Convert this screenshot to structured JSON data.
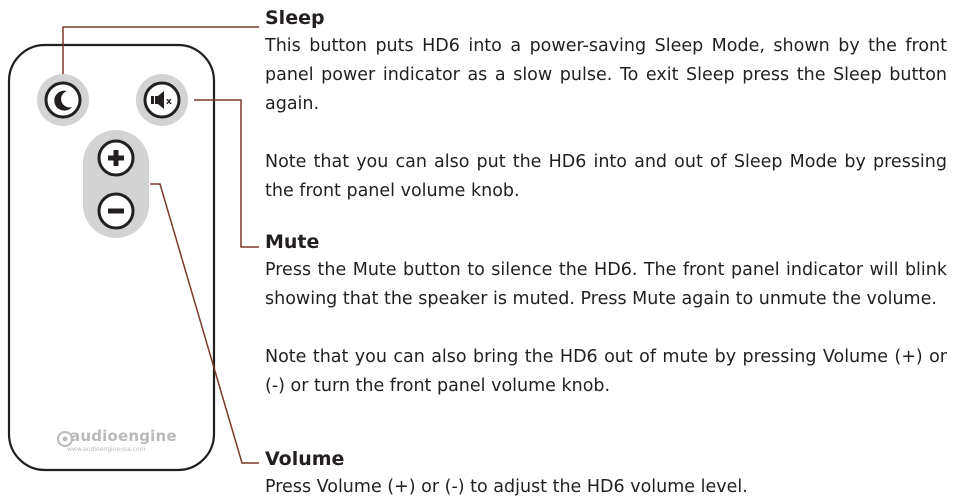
{
  "remote": {
    "buttons": [
      {
        "name": "sleep-button",
        "icon": "moon-icon"
      },
      {
        "name": "mute-button",
        "icon": "speaker-mute-icon",
        "label": "x"
      },
      {
        "name": "volume-up-button",
        "icon": "plus-icon"
      },
      {
        "name": "volume-down-button",
        "icon": "minus-icon"
      }
    ],
    "brand": "audioengine",
    "brand_url": "www.audioengineusa.com"
  },
  "sections": {
    "sleep": {
      "title": "Sleep",
      "p1": "This button puts HD6 into a power-saving Sleep Mode, shown by the front panel power indicator as a slow pulse. To exit Sleep press the Sleep button again.",
      "p2": "Note that you can also put the HD6 into and out of Sleep Mode by pressing the front panel volume knob."
    },
    "mute": {
      "title": "Mute",
      "p1": "Press the Mute button to silence the HD6. The front panel indicator will blink showing that the speaker is muted. Press Mute again to unmute the volume.",
      "p2": "Note that you can also bring the HD6 out of mute by pressing Volume (+) or (-) or turn the front panel volume knob."
    },
    "volume": {
      "title": "Volume",
      "p1": "Press Volume (+) or (-) to adjust the HD6 volume level."
    }
  },
  "colors": {
    "callout_line": "#7a3a2a",
    "button_ring": "#d3d3d3",
    "remote_outline": "#231f20",
    "text": "#231f20"
  }
}
